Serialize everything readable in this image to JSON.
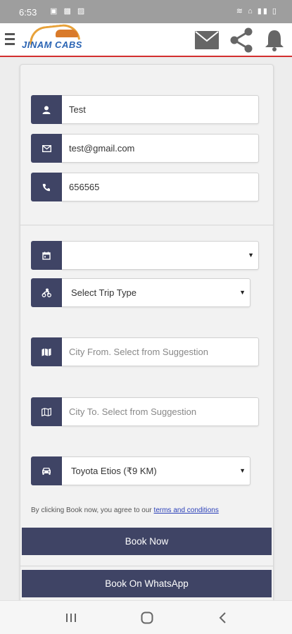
{
  "status_bar": {
    "time": "6:53"
  },
  "header": {
    "logo_text": "JINAM CABS"
  },
  "form": {
    "name_value": "Test",
    "email_value": "test@gmail.com",
    "phone_value": "656565",
    "date_value": "",
    "trip_type_value": "Select Trip Type",
    "city_from_placeholder": "City From. Select from Suggestion",
    "city_to_placeholder": "City To. Select from Suggestion",
    "car_value": "Toyota Etios (₹9 KM)",
    "terms_prefix": "By clicking Book now, you agree to our ",
    "terms_link": "terms and conditions"
  },
  "buttons": {
    "book_now": "Book Now",
    "book_whatsapp": "Book On WhatsApp"
  },
  "colors": {
    "accent": "#3f4465",
    "header_border": "#d32f2f",
    "logo_blue": "#2a64b4",
    "logo_orange": "#e8a23a"
  },
  "icons": [
    "user-icon",
    "envelope-icon",
    "phone-icon",
    "calendar-icon",
    "trip-icon",
    "map-icon",
    "car-icon",
    "mail-icon",
    "share-icon",
    "bell-icon"
  ]
}
